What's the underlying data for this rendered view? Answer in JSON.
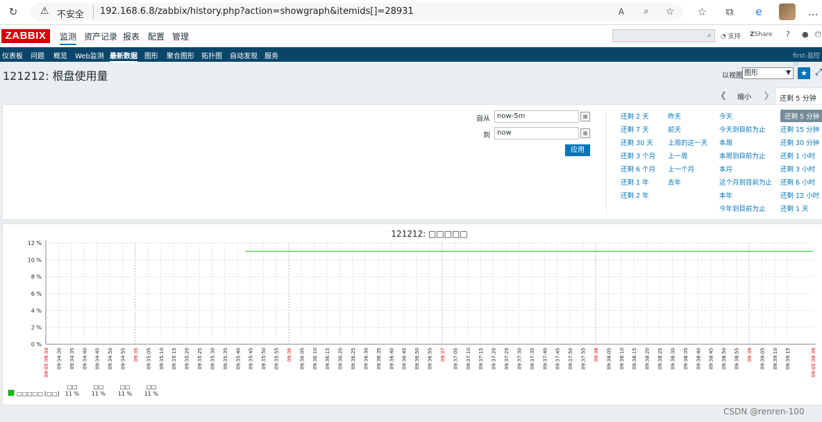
{
  "browser": {
    "insecure_label": "不安全",
    "url": "192.168.6.8/zabbix/history.php?action=showgraph&itemids[]=28931"
  },
  "header": {
    "logo": "ZABBIX",
    "menu": [
      "监测",
      "资产记录",
      "报表",
      "配置",
      "管理"
    ],
    "active_menu": "监测",
    "support": "支持",
    "share": "Share",
    "help": "?"
  },
  "subnav": {
    "items": [
      "仪表板",
      "问题",
      "概览",
      "Web监测",
      "最新数据",
      "图形",
      "聚合图形",
      "拓扑图",
      "自动发现",
      "服务"
    ],
    "active": "最新数据",
    "right_text": "first-监控中"
  },
  "page": {
    "title": "121212: 根盘使用量",
    "view_as_label": "以视图",
    "view_as_value": "图形"
  },
  "time_controls": {
    "zoom_out": "缩小",
    "tab_label": "还剩 5 分钟"
  },
  "filter": {
    "from_label": "自从",
    "from_value": "now-5m",
    "to_label": "到",
    "to_value": "now",
    "apply": "应用",
    "quick_ranges": [
      [
        "还剩 2 天",
        "还剩 7 天",
        "还剩 30 天",
        "还剩 3 个月",
        "还剩 6 个月",
        "还剩 1 年",
        "还剩 2 年"
      ],
      [
        "昨天",
        "前天",
        "上周的这一天",
        "上一周",
        "上一个月",
        "去年"
      ],
      [
        "今天",
        "今天到目前为止",
        "本周",
        "本周到目前为止",
        "本月",
        "这个月到目前为止",
        "本年",
        "今年到目前为止"
      ],
      [
        "还剩 5 分钟",
        "还剩 15 分钟",
        "还剩 30 分钟",
        "还剩 1 小时",
        "还剩 3 小时",
        "还剩 6 小时",
        "还剩 12 小时",
        "还剩 1 天"
      ]
    ],
    "selected_quick": "还剩 5 分钟"
  },
  "chart_data": {
    "type": "line",
    "title": "121212: □□□□□",
    "y_tick_labels": [
      "12 %",
      "10 %",
      "8 %",
      "6 %",
      "4 %",
      "2 %",
      "0 %"
    ],
    "ylim": [
      0,
      12
    ],
    "x_start_label": "09-05 09:34",
    "x_end_label": "09-05 09:39",
    "x_tick_labels": [
      "09:34:30",
      "09:34:35",
      "09:34:40",
      "09:34:45",
      "09:34:50",
      "09:34:55",
      "09:35",
      "09:35:05",
      "09:35:10",
      "09:35:15",
      "09:35:20",
      "09:35:25",
      "09:35:30",
      "09:35:35",
      "09:35:40",
      "09:35:45",
      "09:35:50",
      "09:35:55",
      "09:36",
      "09:36:05",
      "09:36:10",
      "09:36:15",
      "09:36:20",
      "09:36:25",
      "09:36:30",
      "09:36:35",
      "09:36:40",
      "09:36:45",
      "09:36:50",
      "09:36:55",
      "09:37",
      "09:37:05",
      "09:37:10",
      "09:37:15",
      "09:37:20",
      "09:37:25",
      "09:37:30",
      "09:37:35",
      "09:37:40",
      "09:37:45",
      "09:37:50",
      "09:37:55",
      "09:38",
      "09:38:05",
      "09:38:10",
      "09:38:15",
      "09:38:20",
      "09:38:25",
      "09:38:30",
      "09:38:35",
      "09:38:40",
      "09:38:45",
      "09:38:50",
      "09:38:55",
      "09:39",
      "09:39:05",
      "09:39:10",
      "09:39:15"
    ],
    "major_ticks": [
      "09:35",
      "09:36",
      "09:37",
      "09:38",
      "09:39"
    ],
    "series": [
      {
        "name": "□□□□□",
        "color": "#00c800",
        "x_start": "09:35:43",
        "x_end": "09:39:25",
        "value": 11
      }
    ],
    "legend": {
      "series_label": "□□□□□",
      "bracket_label": "[□□]",
      "columns": [
        {
          "header": "□□",
          "value": "11 %"
        },
        {
          "header": "□□",
          "value": "11 %"
        },
        {
          "header": "□□",
          "value": "11 %"
        },
        {
          "header": "□□",
          "value": "11 %"
        }
      ]
    },
    "grid": true
  },
  "watermark": "CSDN @renren-100"
}
